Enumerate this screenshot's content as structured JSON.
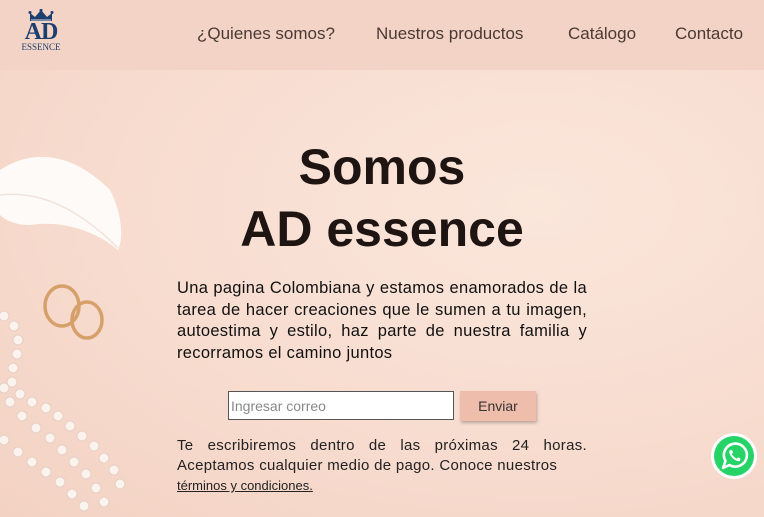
{
  "brand": {
    "logo_main": "AD",
    "logo_sub": "ESSENCE"
  },
  "nav": {
    "about": "¿Quienes somos?",
    "products": "Nuestros productos",
    "catalog": "Catálogo",
    "contact": "Contacto"
  },
  "hero": {
    "title_line1": "Somos",
    "title_line2": "AD essence",
    "description": "Una pagina Colombiana y estamos enamorados de la tarea de hacer creaciones que le sumen a tu imagen, autoestima y estilo, haz parte de nuestra familia y recorramos el camino juntos"
  },
  "form": {
    "email_placeholder": "Ingresar correo",
    "email_value": "",
    "submit_label": "Enviar"
  },
  "note": {
    "text": "Te escribiremos dentro de las próximas 24 horas. Aceptamos cualquier medio de pago. Conoce nuestros",
    "terms_link": "términos y condiciones."
  },
  "icons": {
    "logo_crown": "crown-icon",
    "whatsapp": "whatsapp-icon"
  },
  "colors": {
    "nav_bg": "#f2d3c6",
    "hero_bg": "#f8dfd2",
    "button_bg": "#efbdac",
    "logo_blue": "#1c3f6e",
    "whatsapp_green": "#25d366"
  }
}
